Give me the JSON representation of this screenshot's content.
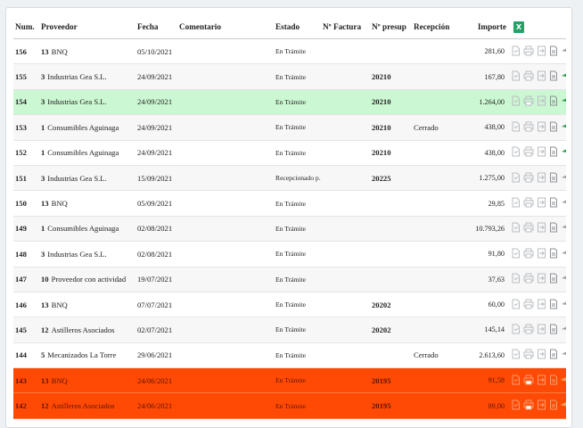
{
  "headers": {
    "num": "Num.",
    "proveedor": "Proveedor",
    "fecha": "Fecha",
    "comentario": "Comentario",
    "estado": "Estado",
    "factura": "Nº Factura",
    "presup": "Nº presup",
    "recepcion": "Recepción",
    "importe": "Importe",
    "excel_icon": "excel-icon"
  },
  "icons": [
    "document-icon",
    "print-icon",
    "export-icon",
    "file-icon",
    "send-icon"
  ],
  "colors": {
    "highlight_green": "#ccf7d3",
    "highlight_orange": "#ff4a05",
    "send_green": "#2e9e4f"
  },
  "rows": [
    {
      "num": "156",
      "prov_id": "13",
      "prov_name": "BNQ",
      "fecha": "05/10/2021",
      "comentario": "",
      "estado": "En Trámite",
      "factura": "",
      "presup": "",
      "recepcion": "",
      "importe": "281,60",
      "style": "plain",
      "send_active": false
    },
    {
      "num": "155",
      "prov_id": "3",
      "prov_name": "Industrias Gea S.L.",
      "fecha": "24/09/2021",
      "comentario": "",
      "estado": "En Trámite",
      "factura": "",
      "presup": "20210",
      "recepcion": "",
      "importe": "167,80",
      "style": "alt",
      "send_active": true
    },
    {
      "num": "154",
      "prov_id": "3",
      "prov_name": "Industrias Gea S.L.",
      "fecha": "24/09/2021",
      "comentario": "",
      "estado": "En Trámite",
      "factura": "",
      "presup": "20210",
      "recepcion": "",
      "importe": "1.264,00",
      "style": "green",
      "send_active": true
    },
    {
      "num": "153",
      "prov_id": "1",
      "prov_name": "Consumibles Aguinaga",
      "fecha": "24/09/2021",
      "comentario": "",
      "estado": "En Trámite",
      "factura": "",
      "presup": "20210",
      "recepcion": "Cerrado",
      "importe": "438,00",
      "style": "alt",
      "send_active": true
    },
    {
      "num": "152",
      "prov_id": "1",
      "prov_name": "Consumibles Aguinaga",
      "fecha": "24/09/2021",
      "comentario": "",
      "estado": "En Trámite",
      "factura": "",
      "presup": "20210",
      "recepcion": "",
      "importe": "438,00",
      "style": "plain",
      "send_active": true
    },
    {
      "num": "151",
      "prov_id": "3",
      "prov_name": "Industrias Gea S.L.",
      "fecha": "15/09/2021",
      "comentario": "",
      "estado": "Recepcionado p...",
      "factura": "",
      "presup": "20225",
      "recepcion": "",
      "importe": "1.275,00",
      "style": "alt",
      "send_active": false
    },
    {
      "num": "150",
      "prov_id": "13",
      "prov_name": "BNQ",
      "fecha": "05/09/2021",
      "comentario": "",
      "estado": "En Trámite",
      "factura": "",
      "presup": "",
      "recepcion": "",
      "importe": "29,85",
      "style": "plain",
      "send_active": false
    },
    {
      "num": "149",
      "prov_id": "1",
      "prov_name": "Consumibles Aguinaga",
      "fecha": "02/08/2021",
      "comentario": "",
      "estado": "En Trámite",
      "factura": "",
      "presup": "",
      "recepcion": "",
      "importe": "10.793,26",
      "style": "alt",
      "send_active": false
    },
    {
      "num": "148",
      "prov_id": "3",
      "prov_name": "Industrias Gea S.L.",
      "fecha": "02/08/2021",
      "comentario": "",
      "estado": "En Trámite",
      "factura": "",
      "presup": "",
      "recepcion": "",
      "importe": "91,80",
      "style": "plain",
      "send_active": false
    },
    {
      "num": "147",
      "prov_id": "10",
      "prov_name": "Proveedor con actividad",
      "fecha": "19/07/2021",
      "comentario": "",
      "estado": "En Trámite",
      "factura": "",
      "presup": "",
      "recepcion": "",
      "importe": "37,63",
      "style": "alt",
      "send_active": false
    },
    {
      "num": "146",
      "prov_id": "13",
      "prov_name": "BNQ",
      "fecha": "07/07/2021",
      "comentario": "",
      "estado": "En Trámite",
      "factura": "",
      "presup": "20202",
      "recepcion": "",
      "importe": "60,00",
      "style": "plain",
      "send_active": false
    },
    {
      "num": "145",
      "prov_id": "12",
      "prov_name": "Astilleros Asociados",
      "fecha": "02/07/2021",
      "comentario": "",
      "estado": "En Trámite",
      "factura": "",
      "presup": "20202",
      "recepcion": "",
      "importe": "145,14",
      "style": "alt",
      "send_active": false
    },
    {
      "num": "144",
      "prov_id": "5",
      "prov_name": "Mecanizados La Torre",
      "fecha": "29/06/2021",
      "comentario": "",
      "estado": "En Trámite",
      "factura": "",
      "presup": "",
      "recepcion": "Cerrado",
      "importe": "2.613,60",
      "style": "plain",
      "send_active": false
    },
    {
      "num": "143",
      "prov_id": "13",
      "prov_name": "BNQ",
      "fecha": "24/06/2021",
      "comentario": "",
      "estado": "En Trámite",
      "factura": "",
      "presup": "20195",
      "recepcion": "",
      "importe": "91,58",
      "style": "orange",
      "send_active": false
    },
    {
      "num": "142",
      "prov_id": "12",
      "prov_name": "Astilleros Asociados",
      "fecha": "24/06/2021",
      "comentario": "",
      "estado": "En Trámite",
      "factura": "",
      "presup": "20195",
      "recepcion": "",
      "importe": "89,00",
      "style": "orange",
      "send_active": false
    }
  ]
}
